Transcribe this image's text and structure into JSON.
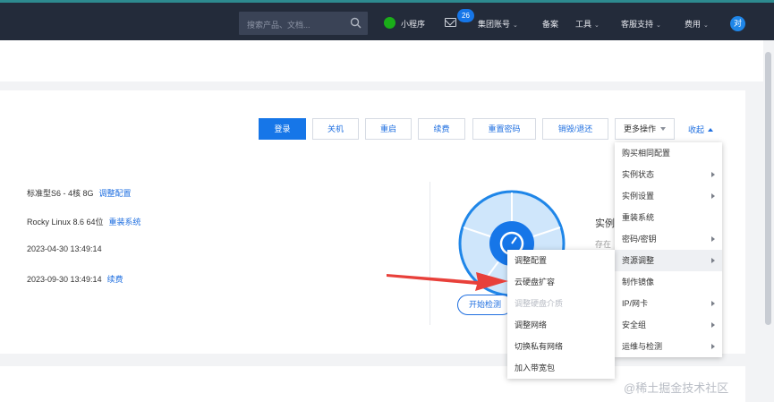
{
  "topnav": {
    "search_placeholder": "搜索产品、文档...",
    "miniprogram": "小程序",
    "mail_badge": "26",
    "group_account": "集团账号",
    "record": "备案",
    "tools": "工具",
    "support": "客服支持",
    "fees": "费用",
    "avatar_text": "对"
  },
  "actions": {
    "login": "登录",
    "shutdown": "关机",
    "restart": "重启",
    "renew": "续费",
    "reset_password": "重置密码",
    "destroy_return": "销毁/退还",
    "more_ops": "更多操作",
    "collapse": "收起"
  },
  "info": {
    "spec": "标准型S6 - 4核 8G",
    "spec_link": "调整配置",
    "os": "Rocky Linux 8.6 64位",
    "os_link": "重装系统",
    "created": "2023-04-30 13:49:14",
    "expire": "2023-09-30 13:49:14",
    "expire_link": "续费"
  },
  "health": {
    "title": "实例",
    "sub": "存在",
    "check_button": "开始检测"
  },
  "more_menu": [
    {
      "label": "购买相同配置",
      "has_sub": false
    },
    {
      "label": "实例状态",
      "has_sub": true
    },
    {
      "label": "实例设置",
      "has_sub": true
    },
    {
      "label": "重装系统",
      "has_sub": false
    },
    {
      "label": "密码/密钥",
      "has_sub": true
    },
    {
      "label": "资源调整",
      "has_sub": true
    },
    {
      "label": "制作镜像",
      "has_sub": false
    },
    {
      "label": "IP/网卡",
      "has_sub": true
    },
    {
      "label": "安全组",
      "has_sub": true
    },
    {
      "label": "运维与检测",
      "has_sub": true
    }
  ],
  "sub_menu": [
    {
      "label": "调整配置",
      "disabled": false
    },
    {
      "label": "云硬盘扩容",
      "disabled": false
    },
    {
      "label": "调整硬盘介质",
      "disabled": true
    },
    {
      "label": "调整网络",
      "disabled": false
    },
    {
      "label": "切换私有网络",
      "disabled": false
    },
    {
      "label": "加入带宽包",
      "disabled": false
    }
  ],
  "watermark": "@稀土掘金技术社区",
  "colors": {
    "primary": "#1676e8",
    "nav_bg": "#232b3a",
    "arrow": "#e8403a"
  }
}
